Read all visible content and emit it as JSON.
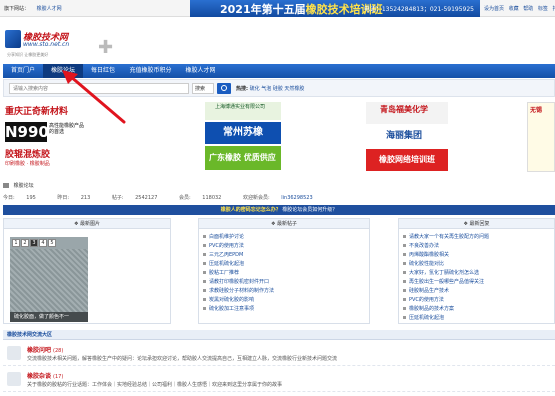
{
  "topbar": {
    "left_text": "旗下网站：",
    "left_link": "橡胶人才网"
  },
  "banner": {
    "title_prefix": "2021年第十五届",
    "title_highlight": "橡胶技术培训班",
    "phone": "电话：13524284813；021-59195925"
  },
  "toplinks": [
    "设为首页",
    "收藏",
    "帮助",
    "标签",
    "排行",
    "搜索"
  ],
  "logo": {
    "title": "橡胶技术网",
    "url": "www.sto.net.cn",
    "slogan": "分享知识 让橡胶更美好"
  },
  "nav": {
    "items": [
      "首页门户",
      "橡胶论坛",
      "每日红包",
      "充值橡胶币积分",
      "橡胶人才网"
    ],
    "active_index": 1
  },
  "search": {
    "placeholder": "请输入搜索内容",
    "select_value": "搜索",
    "hot_label": "热搜:",
    "hot_terms": [
      "硫化",
      "气泡",
      "硅胶",
      "天然橡胶"
    ]
  },
  "ads": {
    "ad1": {
      "line1": "重庆正奇新材料",
      "brand": "N990",
      "desc": "高性能橡胶产品的首选",
      "line2": "胶辊混炼胶",
      "line3": "印刷橡胶 · 橡胶制品"
    },
    "ad2": {
      "line1": "上海博通实业有限公司",
      "line2": "常州苏橡",
      "line3": "广东橡胶 优质供应"
    },
    "ad3": {
      "line1": "青岛福美化学",
      "line2": "海丽集团",
      "line3": "橡胶网络培训班"
    },
    "ad4": {
      "line1": "无锡"
    }
  },
  "breadcrumb": {
    "home_icon": "home-icon",
    "items": [
      "橡胶论坛"
    ]
  },
  "stats": {
    "today_label": "今日:",
    "today": "195",
    "yesterday_label": "昨日:",
    "yesterday": "213",
    "posts_label": "帖子:",
    "posts": "2542127",
    "members_label": "会员:",
    "members": "118032",
    "welcome_label": "欢迎新会员:",
    "newest_member": "lin36298523"
  },
  "tipbar": {
    "q": "橡胶人的密码忘记怎么办？",
    "a": "橡胶论坛会员如何升级？"
  },
  "panels": {
    "latest_images": {
      "header": "最新图片",
      "slide_numbers": [
        "1",
        "2",
        "3",
        "4",
        "5"
      ],
      "active_slide": 2,
      "caption": "硫化胶面，做了颜色不一"
    },
    "latest_posts": {
      "header": "最新帖子",
      "items": [
        "白面机维护讨论",
        "PVC的使用方法",
        "三元乙丙EPDM",
        "压延机硫化起泡",
        "胶粘工厂推荐",
        "请教打印橡胶机密封件开口",
        "求教硅胶分子材料的制作方法",
        "炭黑对硫化胶的影响",
        "硫化胶加工注意事项"
      ]
    },
    "latest_replies": {
      "header": "最新回复",
      "items": [
        "请教大家一个有关再生胶配方的问题",
        "不良改善办法",
        "丙烯酸酯橡胶相关",
        "硫化胶性能对比",
        "大家好，氢化丁腈硫化剂怎么选",
        "再生胶出生一般哪些产品值得关注",
        "硅胶制品生产技术",
        "PVC的使用方法",
        "橡胶制品的技术方案",
        "压延机硫化起泡"
      ]
    }
  },
  "forum_section": {
    "title": "橡胶技术网交流大区",
    "forums": [
      {
        "name": "橡胶问吧",
        "count": "(28)",
        "desc": "交流橡胶技术相关问题，解答橡胶生产中的疑问：论坛承担欢迎讨论，帮助胶人交流提高自己，互相建立人脉，交流橡胶行业新技术问题交流"
      },
      {
        "name": "橡胶杂谈",
        "count": "(17)",
        "desc": "关于橡胶的胶粘的行业话题：工作体会｜实地经验总结｜公司福利｜橡胶人生感悟｜欢迎来到这里分享属于你的故事"
      }
    ]
  }
}
